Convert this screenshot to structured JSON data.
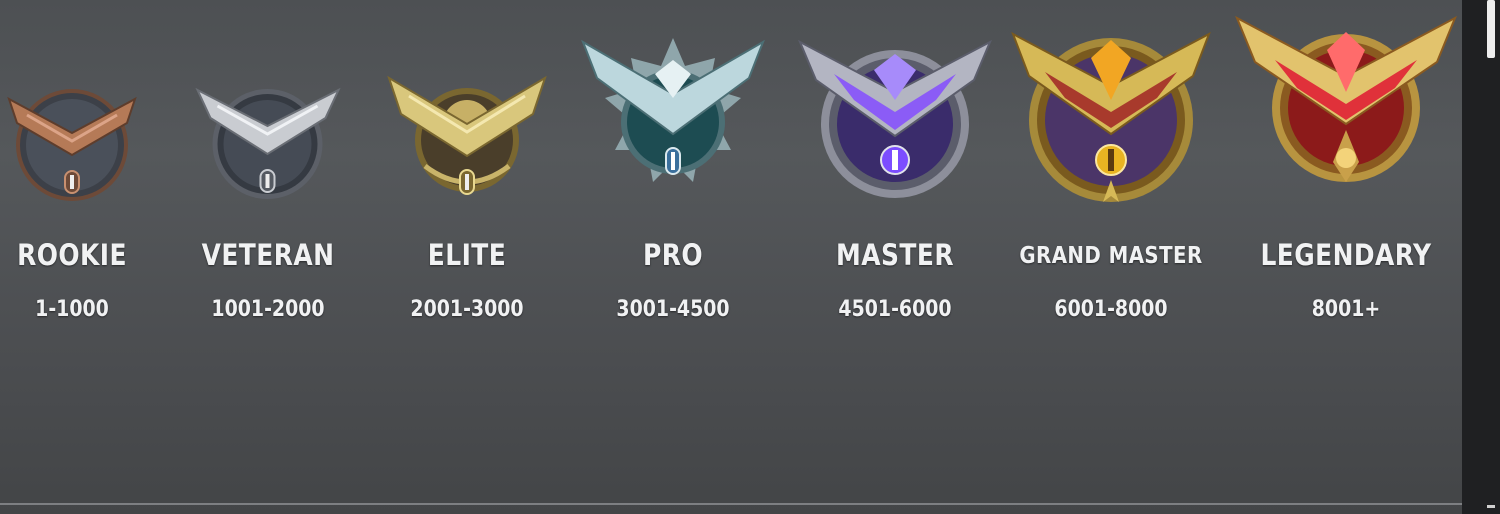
{
  "ranks": [
    {
      "name": "ROOKIE",
      "range": "1-1000",
      "colors": {
        "metal": "#b57a57",
        "dark": "#5e3d2c",
        "inner": "#373b42"
      },
      "icon": "rookie-badge-icon"
    },
    {
      "name": "VETERAN",
      "range": "1001-2000",
      "colors": {
        "metal": "#c9ccd1",
        "dark": "#6a6e75",
        "inner": "#353a42"
      },
      "icon": "veteran-badge-icon"
    },
    {
      "name": "ELITE",
      "range": "2001-3000",
      "colors": {
        "metal": "#d9c77c",
        "dark": "#7a6730",
        "inner": "#4a3e2a"
      },
      "icon": "elite-badge-icon"
    },
    {
      "name": "PRO",
      "range": "3001-4500",
      "colors": {
        "metal": "#bcd7dd",
        "dark": "#4c6f75",
        "inner": "#1d4c52"
      },
      "icon": "pro-badge-icon"
    },
    {
      "name": "MASTER",
      "range": "4501-6000",
      "colors": {
        "metal": "#b3b5c2",
        "dark": "#5b5d6b",
        "inner": "#3a2c6b",
        "accent": "#8b5cf6"
      },
      "icon": "master-badge-icon"
    },
    {
      "name": "GRAND MASTER",
      "range": "6001-8000",
      "colors": {
        "metal": "#d6b957",
        "dark": "#7a5a1e",
        "inner": "#4b3568",
        "accent": "#f2a623"
      },
      "icon": "grand-master-badge-icon"
    },
    {
      "name": "LEGENDARY",
      "range": "8001+",
      "colors": {
        "metal": "#e2c36d",
        "dark": "#8a5a20",
        "inner": "#8c1a1a",
        "accent": "#e0313a"
      },
      "icon": "legendary-badge-icon"
    }
  ]
}
